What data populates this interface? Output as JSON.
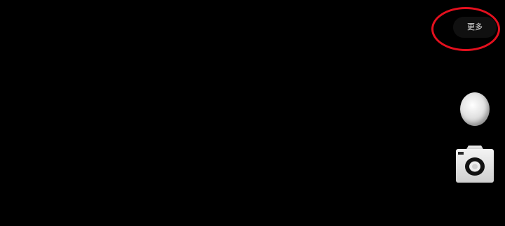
{
  "screen": {
    "background": "#000000"
  },
  "controls": {
    "more_label": "更多",
    "highlight_color": "#e3101e",
    "shutter_icon": "shutter-circle",
    "mode_icon": "camera-icon"
  }
}
